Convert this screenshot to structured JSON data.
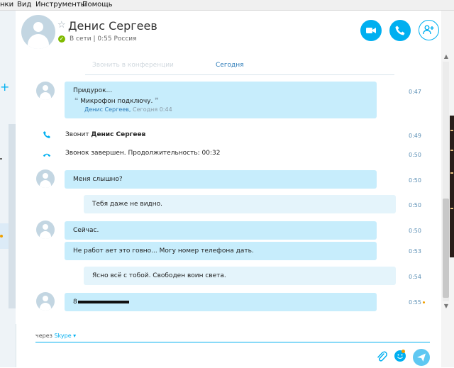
{
  "menu": {
    "item_cut": "нки",
    "view": "Вид",
    "tools": "Инструменты",
    "help": "Помощь"
  },
  "header": {
    "contact_name": "Денис Сергеев",
    "status": "В сети | 0:55 Россия"
  },
  "chat": {
    "date_ghost": "Звонить в конференции",
    "date_label": "Сегодня",
    "messages": [
      {
        "text": "Придурок...",
        "time": "0:47",
        "quote": {
          "text": "Микрофон подключу.",
          "author": "Денис Сергеев",
          "date": "Сегодня 0:44"
        }
      },
      {
        "call_prefix": "Звонит ",
        "call_name": "Денис Сергеев",
        "time": "0:49"
      },
      {
        "text": "Звонок завершен. Продолжительность: 00:32",
        "time": "0:50"
      },
      {
        "text": "Меня слышно?",
        "time": "0:50"
      },
      {
        "text": "Тебя даже не видно.",
        "time": "0:50"
      },
      {
        "text": "Сейчас.",
        "time": "0:50"
      },
      {
        "text": "Не работ ает это говно... Могу номер телефона дать.",
        "time": "0:53"
      },
      {
        "text": "Ясно всё с тобой. Свободен воин света.",
        "time": "0:54"
      },
      {
        "text": "8",
        "time": "0:55"
      }
    ]
  },
  "composer": {
    "via_prefix": "через",
    "via_service": "Skype ▾"
  },
  "colors": {
    "accent": "#00aff0",
    "bubble_in": "#c7edfc",
    "bubble_out": "#e4f4fb",
    "online": "#7fba00"
  },
  "icons": [
    "star-icon",
    "video-call-icon",
    "call-icon",
    "add-contact-icon",
    "phone-incoming-icon",
    "phone-end-icon",
    "attach-icon",
    "emoticon-icon",
    "send-icon"
  ]
}
